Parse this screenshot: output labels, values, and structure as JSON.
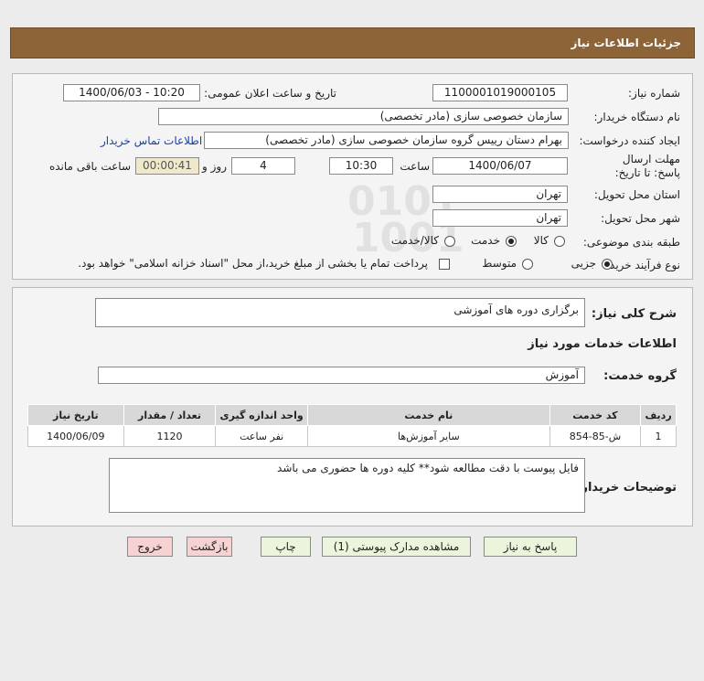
{
  "header": {
    "title": "جزئیات اطلاعات نیاز"
  },
  "form": {
    "need_number_label": "شماره نیاز:",
    "need_number_value": "1100001019000105",
    "announce_label": "تاریخ و ساعت اعلان عمومی:",
    "announce_value": "1400/06/03 - 10:20",
    "buyer_org_label": "نام دستگاه خریدار:",
    "buyer_org_value": "سازمان خصوصی سازی (مادر تخصصی)",
    "creator_label": "ایجاد کننده درخواست:",
    "creator_value": "بهرام دستان رییس گروه سازمان خصوصی سازی (مادر تخصصی)",
    "contact_link": "اطلاعات تماس خریدار",
    "deadline_label": "مهلت ارسال پاسخ: تا تاریخ:",
    "deadline_date": "1400/06/07",
    "time_label": "ساعت",
    "deadline_time": "10:30",
    "days_value": "4",
    "days_label": "روز و",
    "remaining_value": "00:00:41",
    "remaining_label": "ساعت باقی مانده",
    "province_label": "استان محل تحویل:",
    "province_value": "تهران",
    "city_label": "شهر محل تحویل:",
    "city_value": "تهران",
    "category_label": "طبقه بندی موضوعی:",
    "category_options": [
      "کالا",
      "خدمت",
      "کالا/خدمت"
    ],
    "category_selected": "خدمت",
    "process_label": "نوع فرآیند خرید :",
    "process_options": [
      "جزیی",
      "متوسط"
    ],
    "process_selected": "جزیی",
    "payment_note": "پرداخت تمام یا بخشی از مبلغ خرید،از محل \"اسناد خزانه اسلامی\" خواهد بود."
  },
  "section2": {
    "summary_label": "شرح کلی نیاز:",
    "summary_value": "برگزاری دوره های آموزشی",
    "services_heading": "اطلاعات خدمات مورد نیاز",
    "service_group_label": "گروه خدمت:",
    "service_group_value": "آموزش",
    "table": {
      "headers": [
        "ردیف",
        "کد خدمت",
        "نام خدمت",
        "واحد اندازه گیری",
        "تعداد / مقدار",
        "تاریخ نیاز"
      ],
      "rows": [
        [
          "1",
          "ش-85-854",
          "سایر آموزش‌ها",
          "نفر ساعت",
          "1120",
          "1400/06/09"
        ]
      ]
    },
    "buyer_notes_label": "توضیحات خریدار:",
    "buyer_notes_value": "فایل پیوست با دقت مطالعه شود** کلیه دوره ها حضوری می باشد"
  },
  "buttons": {
    "reply": "پاسخ به نیاز",
    "view_docs": "مشاهده مدارک پیوستی (1)",
    "print": "چاپ",
    "back": "بازگشت",
    "exit": "خروج"
  },
  "colors": {
    "header_bg": "#8d6438",
    "panel_bg": "#f4f4f4",
    "button_green": "#eaf5dc",
    "button_red": "#f7d2d2",
    "timer_bg": "#efe8c9",
    "link": "#1a3fa8"
  }
}
